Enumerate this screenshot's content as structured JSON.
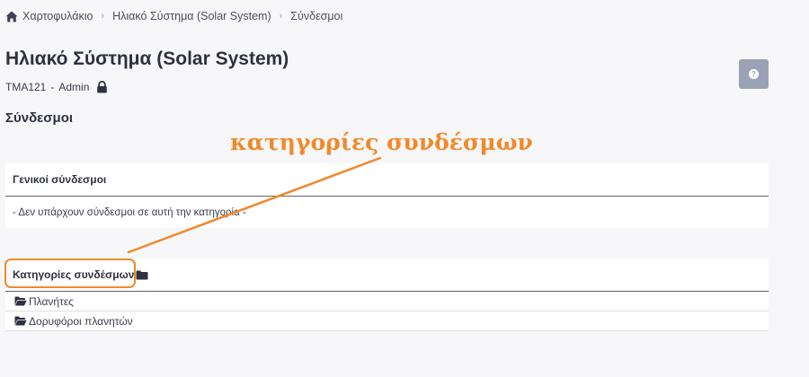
{
  "breadcrumb": {
    "home": "Χαρτοφυλάκιο",
    "course": "Ηλιακό Σύστημα (Solar System)",
    "current": "Σύνδεσμοι"
  },
  "course": {
    "title": "Ηλιακό Σύστημα (Solar System)",
    "code": "TMA121",
    "role": "Admin"
  },
  "help_button": {
    "label": "?"
  },
  "section": {
    "heading": "Σύνδεσμοι"
  },
  "annotation": {
    "text": "κατηγορίες συνδέσμων",
    "color": "#f08a2b"
  },
  "general_links": {
    "heading": "Γενικοί σύνδεσμοι",
    "empty_message": "- Δεν υπάρχουν σύνδεσμοι σε αυτή την κατηγορία -"
  },
  "link_categories": {
    "heading": "Κατηγορίες συνδέσμων",
    "items": [
      {
        "label": "Πλανήτες"
      },
      {
        "label": "Δορυφόροι πλανητών"
      }
    ]
  },
  "colors": {
    "accent_orange": "#f08a2b",
    "text_dark": "#2f3140",
    "help_button_bg": "#9aa3b5"
  }
}
